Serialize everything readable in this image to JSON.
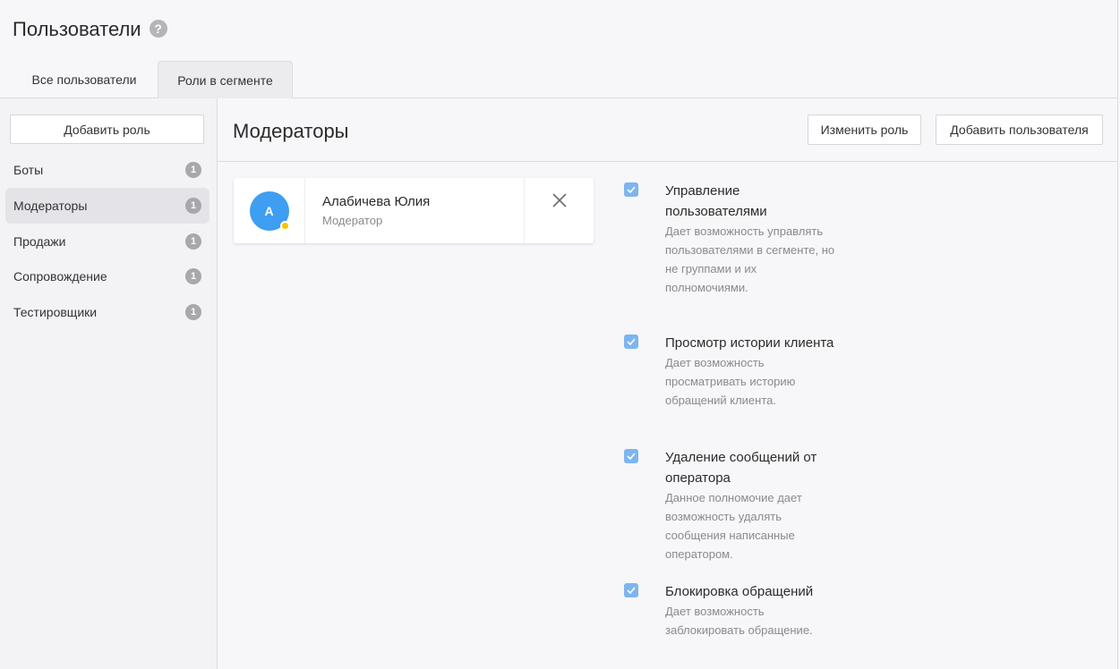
{
  "page": {
    "title": "Пользователи",
    "help_glyph": "?"
  },
  "tabs": [
    {
      "label": "Все пользователи",
      "active": false
    },
    {
      "label": "Роли в сегменте",
      "active": true
    }
  ],
  "sidebar": {
    "add_role_label": "Добавить роль",
    "roles": [
      {
        "label": "Боты",
        "count": "1",
        "active": false
      },
      {
        "label": "Модераторы",
        "count": "1",
        "active": true
      },
      {
        "label": "Продажи",
        "count": "1",
        "active": false
      },
      {
        "label": "Сопровождение",
        "count": "1",
        "active": false
      },
      {
        "label": "Тестировщики",
        "count": "1",
        "active": false
      }
    ]
  },
  "main": {
    "role_title": "Модераторы",
    "edit_role_label": "Изменить роль",
    "add_user_label": "Добавить пользователя"
  },
  "user": {
    "initial": "А",
    "name": "Алабичева Юлия",
    "role": "Модератор",
    "status_color": "#f5c400",
    "avatar_color": "#3d9ef2"
  },
  "permissions": [
    {
      "title": "Управление пользователями",
      "description": "Дает возможность управлять пользователями в сегменте, но не группами и их полномочиями.",
      "checked": true
    },
    {
      "title": "Просмотр истории клиента",
      "description": "Дает возможность просматривать историю обращений клиента.",
      "checked": true
    },
    {
      "title": "Удаление сообщений от оператора",
      "description": "Данное полномочие дает возможность удалять сообщения написанные оператором.",
      "checked": true
    },
    {
      "title": "Блокировка обращений",
      "description": "Дает возможность заблокировать обращение.",
      "checked": true
    }
  ],
  "colors": {
    "accent": "#7eb5f0",
    "badge": "#a8a8ac"
  }
}
